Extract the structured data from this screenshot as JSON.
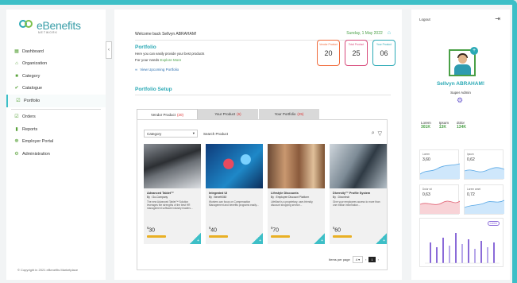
{
  "brand": {
    "name": "eBenefits",
    "tagline": "NETWORK"
  },
  "sidebar": {
    "items": [
      {
        "label": "Dashboard",
        "icon": "dashboard-icon"
      },
      {
        "label": "Organization",
        "icon": "organization-icon"
      },
      {
        "label": "Category",
        "icon": "category-icon"
      },
      {
        "label": "Catalogue",
        "icon": "catalogue-icon"
      },
      {
        "label": "Portfolio",
        "icon": "portfolio-icon",
        "active": true
      },
      {
        "label": "Orders",
        "icon": "orders-icon"
      },
      {
        "label": "Reports",
        "icon": "reports-icon"
      },
      {
        "label": "Employer Portal",
        "icon": "employer-portal-icon"
      },
      {
        "label": "Administration",
        "icon": "administration-icon"
      }
    ],
    "copyright": "© Copyright in 2021 eBenefits Marketplace"
  },
  "header": {
    "welcome": "Welcome back Sellvyn ABRAHAM!",
    "date": "Sunday, 1 May 2022"
  },
  "portfolio": {
    "title": "Portfolio",
    "description": "Here you can easily provide your best products",
    "needs_prefix": "For your needs",
    "needs_link": "Explore More",
    "view_link": "View Upcoming Portfolio",
    "cards": [
      {
        "label": "Vendor Product",
        "value": "20"
      },
      {
        "label": "Total Product",
        "value": "25"
      },
      {
        "label": "Your Product",
        "value": "06"
      }
    ]
  },
  "setup": {
    "title": "Portfolio Setup",
    "tabs": [
      {
        "label": "Vendor Product",
        "count": "(20)"
      },
      {
        "label": "Your Product",
        "count": "(6)"
      },
      {
        "label": "Your Portfolio",
        "count": "(25)"
      }
    ],
    "category_placeholder": "Category",
    "search_placeholder": "Search Product",
    "products": [
      {
        "title": "Advanced Tablet™",
        "by": "By : Go-Company",
        "desc": "The new Advanced Tablet™ Solution leverages the strengths of the best HR management software industry leaders...",
        "price": "30"
      },
      {
        "title": "Integrated UI",
        "by": "By : Benefit360",
        "desc": "Workers can focus on Compensation Management and benefits programs easily...",
        "price": "40"
      },
      {
        "title": "Lifestyle Discounts",
        "by": "By : Employee Discount Platform",
        "desc": "LifeMart is a proprietary, user-friendly, discount shopping service...",
        "price": "70"
      },
      {
        "title": "Diversity™ Profile System",
        "by": "By : Dixontech",
        "desc": "Give your employees access to more than one million information...",
        "price": "60"
      }
    ],
    "pager": {
      "label": "Items per page",
      "per_page": "4",
      "page": "1"
    }
  },
  "right": {
    "logout": "Logout",
    "user_name": "Sellvyn ABRAHAM!",
    "role": "Super Admin",
    "stats": [
      {
        "label": "Lorem",
        "value": "301K"
      },
      {
        "label": "Ipsum",
        "value": "13K"
      },
      {
        "label": "dolor",
        "value": "134K"
      }
    ],
    "minis": [
      {
        "label": "Lorem",
        "value": "3,60"
      },
      {
        "label": "Ipsum",
        "value": "0,62"
      },
      {
        "label": "Dolor sit",
        "value": "0,63"
      },
      {
        "label": "Lorem amet",
        "value": "0,72"
      }
    ],
    "chart_tag": "Lorem"
  },
  "colors": {
    "accent": "#3dbfc7",
    "green": "#4aa046",
    "orange": "#f06a3b",
    "pink": "#d84a7b"
  }
}
